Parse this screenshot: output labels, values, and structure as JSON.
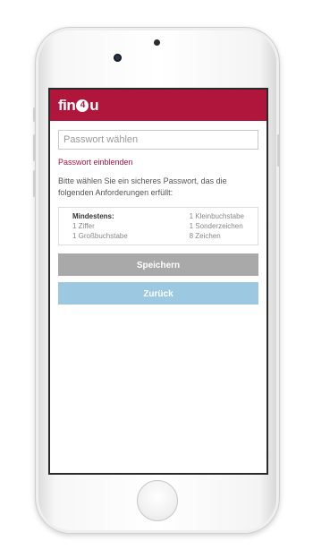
{
  "brand": {
    "logo_prefix": "fin",
    "logo_four": "4",
    "logo_suffix": "u",
    "color": "#b0163b"
  },
  "form": {
    "password_placeholder": "Passwort wählen",
    "show_password_label": "Passwort einblenden",
    "info_text": "Bitte wählen Sie ein sicheres Passwort, das die folgenden Anforderungen erfüllt:"
  },
  "requirements": {
    "heading": "Mindestens:",
    "left": [
      "1 Ziffer",
      "1 Großbuchstabe"
    ],
    "right": [
      "1 Kleinbuchstabe",
      "1 Sonderzeichen",
      "8 Zeichen"
    ]
  },
  "buttons": {
    "save_label": "Speichern",
    "back_label": "Zurück",
    "save_color": "#a9a9a9",
    "back_color": "#9cc9e1"
  }
}
